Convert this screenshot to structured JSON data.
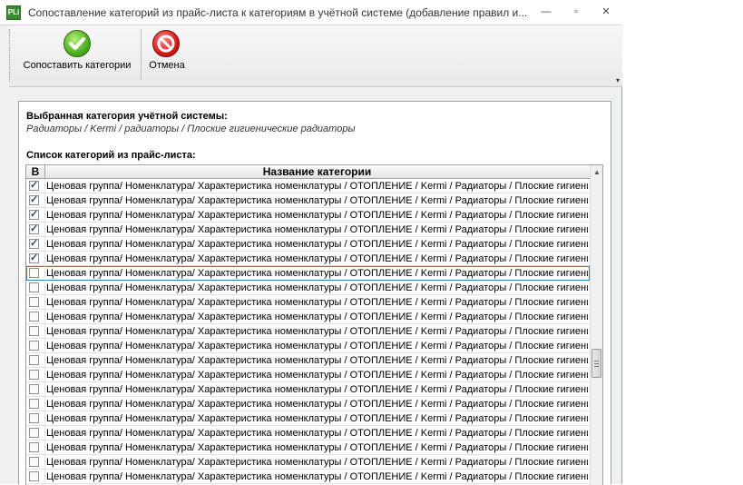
{
  "window": {
    "title": "Сопоставление категорий из прайс-листа к категориям в учётной системе (добавление правил и...",
    "app_icon_text": "PLi",
    "minimize_glyph": "—",
    "maximize_glyph": "▫",
    "close_glyph": "✕"
  },
  "toolbar": {
    "map_label": "Сопоставить категории",
    "cancel_label": "Отмена",
    "map_icon": "green-check-icon",
    "cancel_icon": "no-entry-icon"
  },
  "selected": {
    "label": "Выбранная категория учётной системы:",
    "path": "Радиаторы / Kermi / радиаторы / Плоские гигиенические радиаторы"
  },
  "list": {
    "label": "Список категорий из прайс-листа:",
    "columns": [
      "В",
      "Название категории"
    ],
    "row_text": "Ценовая группа/ Номенклатура/ Характеристика номенклатуры / ОТОПЛЕНИЕ / Kermi / Радиаторы / Плоские гигиенические",
    "rows": [
      {
        "checked": true
      },
      {
        "checked": true
      },
      {
        "checked": true
      },
      {
        "checked": true
      },
      {
        "checked": true
      },
      {
        "checked": true
      },
      {
        "checked": false,
        "current": true
      },
      {
        "checked": false
      },
      {
        "checked": false
      },
      {
        "checked": false
      },
      {
        "checked": false
      },
      {
        "checked": false
      },
      {
        "checked": false
      },
      {
        "checked": false
      },
      {
        "checked": false
      },
      {
        "checked": false
      },
      {
        "checked": false
      },
      {
        "checked": false
      },
      {
        "checked": false
      },
      {
        "checked": false
      },
      {
        "checked": false
      },
      {
        "checked": false
      }
    ]
  },
  "colors": {
    "check": "#2b4a8a",
    "row_focus": "#3c7fb1"
  }
}
